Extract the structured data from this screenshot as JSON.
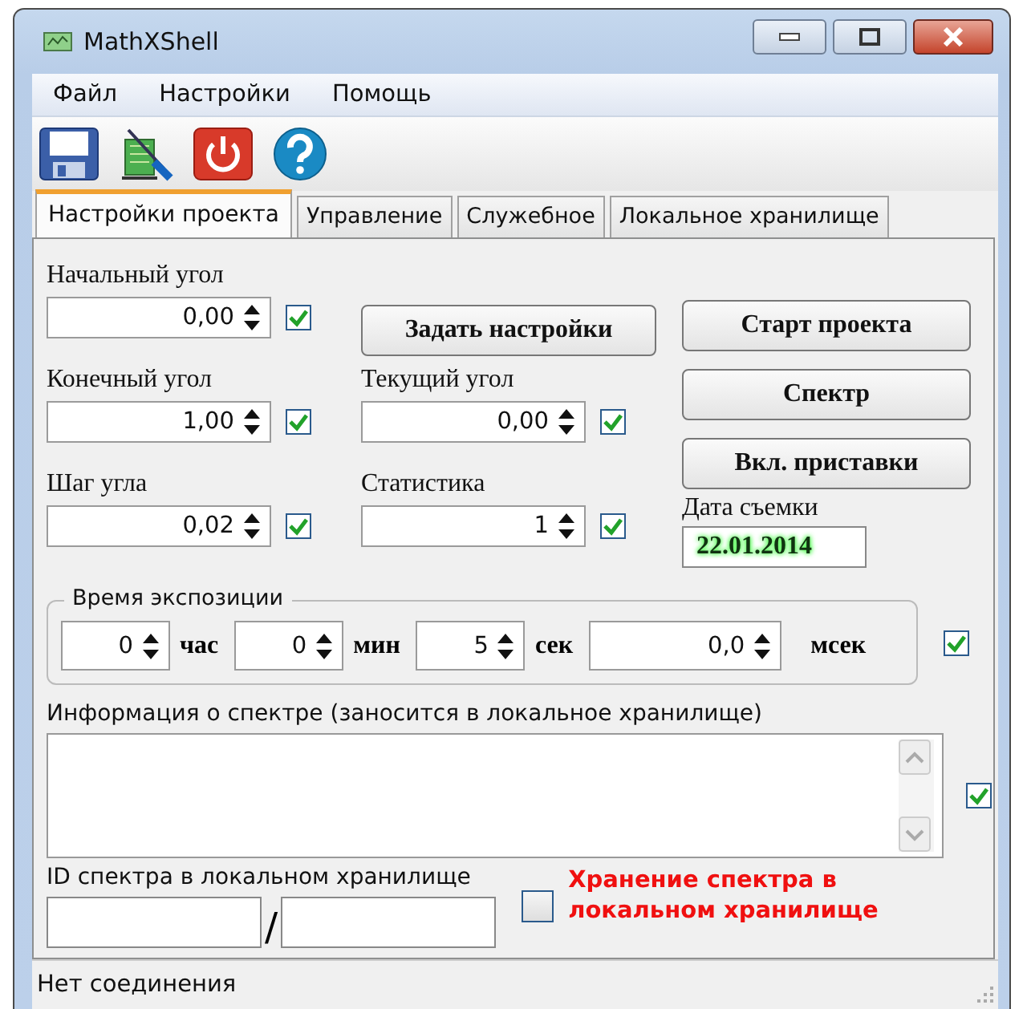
{
  "window": {
    "title": "MathXShell"
  },
  "menu": [
    "Файл",
    "Настройки",
    "Помощь"
  ],
  "tabs": [
    {
      "label": "Настройки проекта",
      "selected": true
    },
    {
      "label": "Управление",
      "selected": false
    },
    {
      "label": "Служебное",
      "selected": false
    },
    {
      "label": "Локальное хранилище",
      "selected": false
    }
  ],
  "fields": [
    {
      "kind": "spin",
      "label": "Начальный угол",
      "value": "0,00",
      "checked": true
    },
    {
      "kind": "button",
      "label": "Задать настройки"
    },
    {
      "kind": "spin",
      "label": "Конечный угол",
      "value": "1,00",
      "checked": true
    },
    {
      "kind": "spin",
      "label": "Текущий угол",
      "value": "0,00",
      "checked": true
    },
    {
      "kind": "spin",
      "label": "Шаг угла",
      "value": "0,02",
      "checked": true
    },
    {
      "kind": "spin",
      "label": "Статистика",
      "value": "1",
      "checked": true
    }
  ],
  "actions": [
    "Старт проекта",
    "Спектр",
    "Вкл. приставки"
  ],
  "date": {
    "label": "Дата съемки",
    "value": "22.01.2014"
  },
  "exposure": {
    "title": "Время экспозиции",
    "checked": true,
    "items": [
      {
        "value": "0",
        "unit": "час"
      },
      {
        "value": "0",
        "unit": "мин"
      },
      {
        "value": "5",
        "unit": "сек"
      },
      {
        "value": "0,0",
        "unit": "мсек"
      }
    ]
  },
  "info": {
    "label": "Информация о спектре (заносится в локальное хранилище)",
    "checked": true
  },
  "spectrum_id": {
    "label": "ID спектра в локальном хранилище",
    "separator": "/"
  },
  "store": {
    "label": "Хранение спектра в локальном хранилище",
    "checked": false
  },
  "status_bar": "Нет соединения"
}
